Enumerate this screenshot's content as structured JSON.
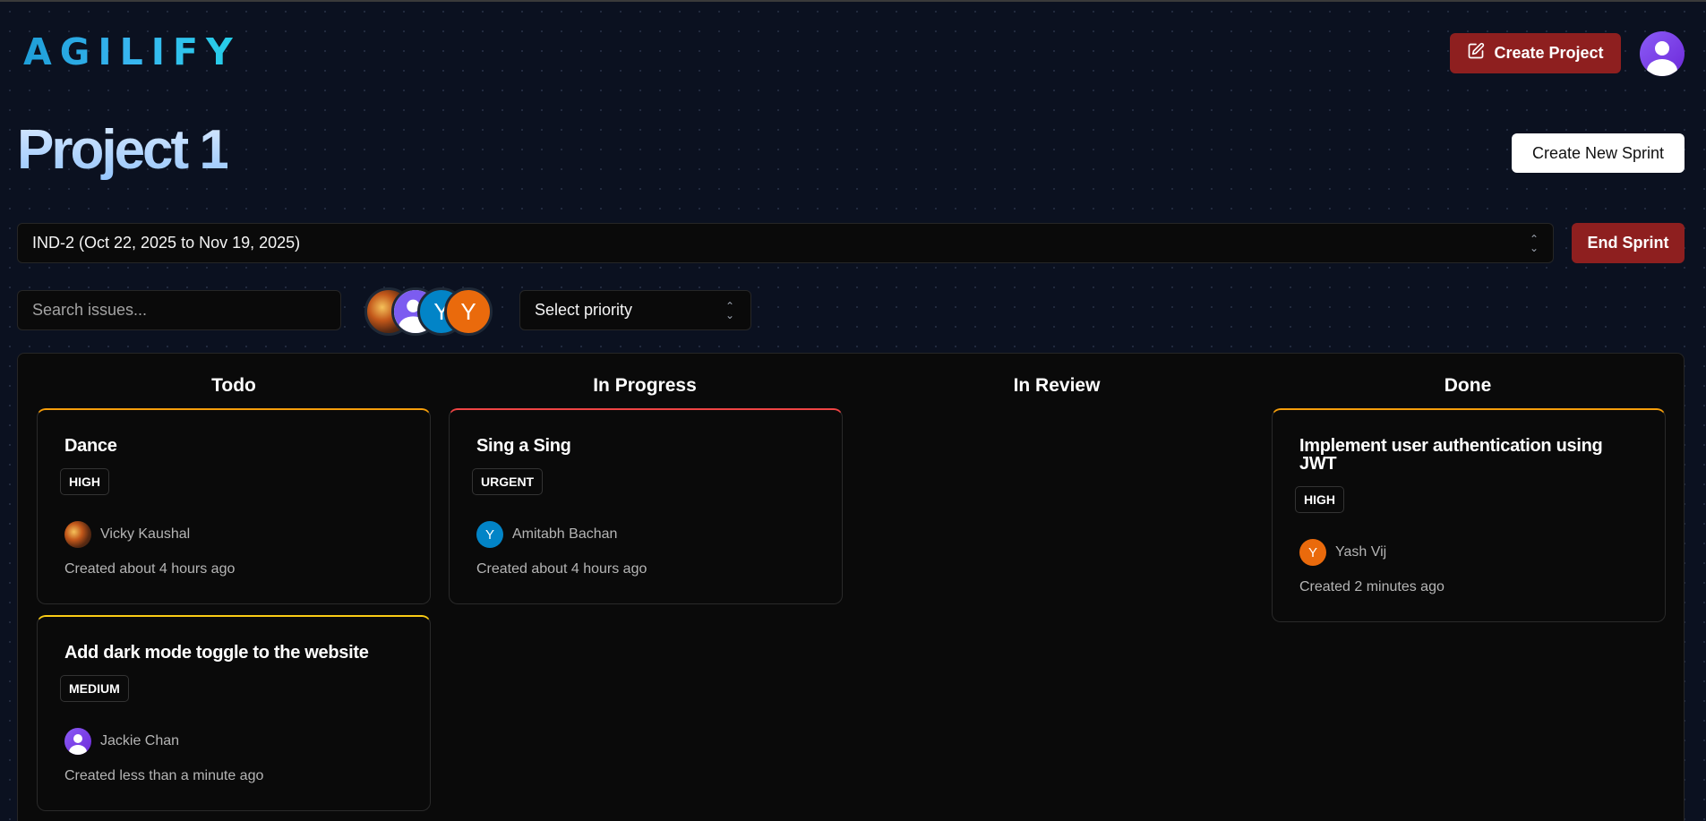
{
  "header": {
    "logo": "AGILIFY",
    "create_project_label": "Create Project"
  },
  "project": {
    "title": "Project 1",
    "create_sprint_label": "Create New Sprint"
  },
  "sprint": {
    "selected": "IND-2 (Oct 22, 2025 to Nov 19, 2025)",
    "end_label": "End Sprint"
  },
  "filters": {
    "search_placeholder": "Search issues...",
    "priority_placeholder": "Select priority",
    "avatars": [
      "photo",
      "default-user",
      "Y",
      "Y"
    ]
  },
  "columns": [
    {
      "title": "Todo"
    },
    {
      "title": "In Progress"
    },
    {
      "title": "In Review"
    },
    {
      "title": "Done"
    }
  ],
  "cards": {
    "todo_1": {
      "title": "Dance",
      "priority": "HIGH",
      "assignee": "Vicky Kaushal",
      "created": "Created about 4 hours ago",
      "accent": "#f59e0b"
    },
    "todo_2": {
      "title": "Add dark mode toggle to the website",
      "priority": "MEDIUM",
      "assignee": "Jackie Chan",
      "created": "Created less than a minute ago",
      "accent": "#facc15"
    },
    "progress_1": {
      "title": "Sing a Sing",
      "priority": "URGENT",
      "assignee": "Amitabh Bachan",
      "assignee_initial": "Y",
      "created": "Created about 4 hours ago",
      "accent": "#ef4444"
    },
    "done_1": {
      "title": "Implement user authentication using JWT",
      "priority": "HIGH",
      "assignee": "Yash Vij",
      "assignee_initial": "Y",
      "created": "Created 2 minutes ago",
      "accent": "#f59e0b"
    }
  },
  "colors": {
    "primary_red": "#8e1f1f",
    "background": "#0b1120",
    "board": "#0a0a0a"
  }
}
